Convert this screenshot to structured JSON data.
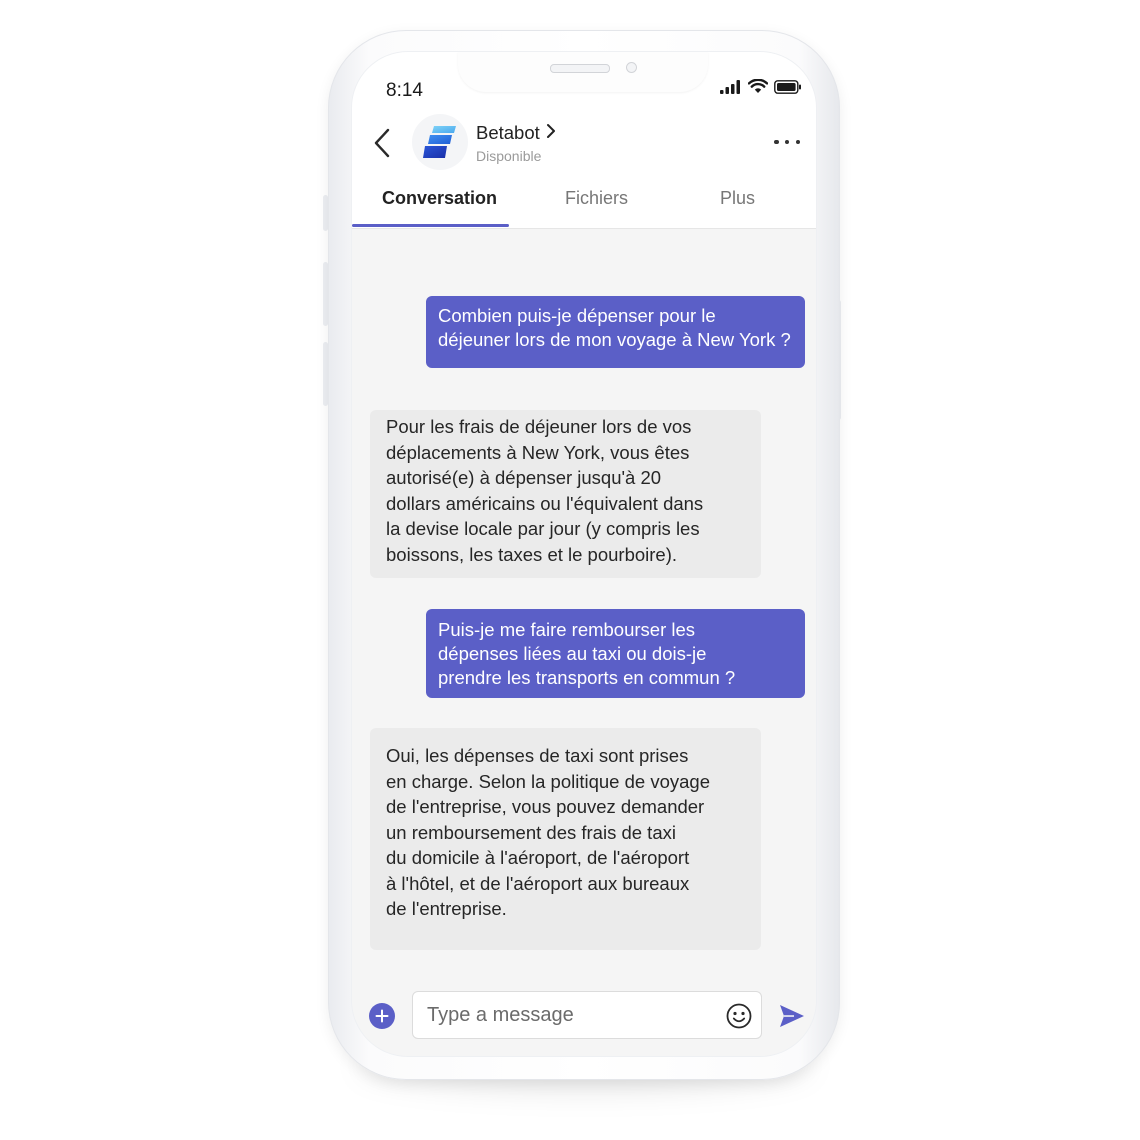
{
  "status_bar": {
    "time": "8:14",
    "icons": [
      "signal-icon",
      "wifi-icon",
      "battery-icon"
    ]
  },
  "header": {
    "back_icon": "chevron-left-icon",
    "bot_name": "Betabot",
    "bot_name_chevron": ">",
    "bot_status": "Disponible",
    "more_icon": "more-horizontal-icon"
  },
  "tabs": [
    {
      "label": "Conversation",
      "active": true
    },
    {
      "label": "Fichiers",
      "active": false
    },
    {
      "label": "Plus",
      "active": false
    }
  ],
  "messages": [
    {
      "sender": "user",
      "text": "Combien puis-je dépenser pour le\ndéjeuner lors de mon voyage à New York ?"
    },
    {
      "sender": "bot",
      "text": "Pour les frais de déjeuner lors de vos\ndéplacements à New York, vous êtes\nautorisé(e) à dépenser jusqu'à 20\ndollars américains ou l'équivalent dans\nla devise locale par jour (y compris les\nboissons, les taxes et le pourboire)."
    },
    {
      "sender": "user",
      "text": "Puis-je me faire rembourser les\ndépenses liées au taxi ou dois-je\nprendre les transports en commun ?"
    },
    {
      "sender": "bot",
      "text": "Oui, les dépenses de taxi sont prises\nen charge. Selon la politique de voyage\nde l'entreprise, vous pouvez demander\nun remboursement des frais de taxi\ndu domicile à l'aéroport, de l'aéroport\nà l'hôtel, et de l'aéroport aux bureaux\nde l'entreprise."
    }
  ],
  "composer": {
    "placeholder": "Type a message",
    "value": "",
    "add_icon": "plus-circle-icon",
    "emoji_icon": "smiley-icon",
    "send_icon": "send-icon"
  },
  "colors": {
    "accent": "#5b5fc7",
    "user_bubble_text": "#ffffff",
    "bot_bubble": "#ebebeb",
    "screen_bg": "#f5f5f5"
  }
}
